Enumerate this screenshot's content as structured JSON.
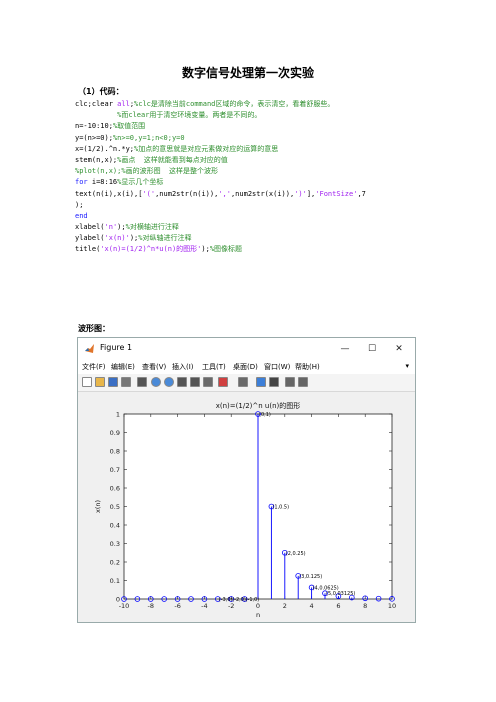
{
  "doc": {
    "title": "数字信号处理第一次实验",
    "section_code": "（1）代码：",
    "section_wave": "波形图："
  },
  "code_lines": [
    [
      {
        "t": "clc;clear ",
        "c": ""
      },
      {
        "t": "all",
        "c": "str"
      },
      {
        "t": ";",
        "c": ""
      },
      {
        "t": "%clc是清除当前command区域的命令，表示清空，看着舒服些。",
        "c": "cm"
      }
    ],
    [
      {
        "t": "          %而clear用于清空环境变量。两者是不同的。",
        "c": "cm"
      }
    ],
    [
      {
        "t": "n=-10:10;",
        "c": ""
      },
      {
        "t": "%取值范围",
        "c": "cm"
      }
    ],
    [
      {
        "t": "y=(n>=0);",
        "c": ""
      },
      {
        "t": "%n>=0,y=1;n<0;y=0",
        "c": "cm"
      }
    ],
    [
      {
        "t": "x=(1/2).^n.*y;",
        "c": ""
      },
      {
        "t": "%加点的意思就是对应元素做对应的运算的意思",
        "c": "cm"
      }
    ],
    [
      {
        "t": "stem(n,x);",
        "c": ""
      },
      {
        "t": "%画点  这样就能看到每点对应的值",
        "c": "cm"
      }
    ],
    [
      {
        "t": "%plot(n,x);%画的波形图  这样是整个波形",
        "c": "cm"
      }
    ],
    [
      {
        "t": "for ",
        "c": "kw"
      },
      {
        "t": "i=8:16",
        "c": ""
      },
      {
        "t": "%显示几个坐标",
        "c": "cm"
      }
    ],
    [
      {
        "t": "text(n(i),x(i),[",
        "c": ""
      },
      {
        "t": "'('",
        "c": "str"
      },
      {
        "t": ",num2str(n(i)),",
        "c": ""
      },
      {
        "t": "','",
        "c": "str"
      },
      {
        "t": ",num2str(x(i)),",
        "c": ""
      },
      {
        "t": "')'",
        "c": "str"
      },
      {
        "t": "],",
        "c": ""
      },
      {
        "t": "'FontSize'",
        "c": "str"
      },
      {
        "t": ",7",
        "c": ""
      }
    ],
    [
      {
        "t": ");",
        "c": ""
      }
    ],
    [
      {
        "t": "end",
        "c": "kw"
      }
    ],
    [
      {
        "t": "xlabel(",
        "c": ""
      },
      {
        "t": "'n'",
        "c": "str"
      },
      {
        "t": ");",
        "c": ""
      },
      {
        "t": "%对横轴进行注释",
        "c": "cm"
      }
    ],
    [
      {
        "t": "ylabel(",
        "c": ""
      },
      {
        "t": "'x(n)'",
        "c": "str"
      },
      {
        "t": ");",
        "c": ""
      },
      {
        "t": "%对纵轴进行注释",
        "c": "cm"
      }
    ],
    [
      {
        "t": "title(",
        "c": ""
      },
      {
        "t": "'x(n)=(1/2)^n*u(n)的图形'",
        "c": "str"
      },
      {
        "t": ");",
        "c": ""
      },
      {
        "t": "%图像标题",
        "c": "cm"
      }
    ]
  ],
  "figure": {
    "window_title": "Figure 1",
    "menu": [
      "文件(F)",
      "编辑(E)",
      "查看(V)",
      "插入(I)",
      "工具(T)",
      "桌面(D)",
      "窗口(W)",
      "帮助(H)"
    ],
    "toolbar_icons": [
      "new-file-icon",
      "open-folder-icon",
      "save-icon",
      "print-icon",
      "pointer-icon",
      "zoom-in-icon",
      "zoom-out-icon",
      "pan-icon",
      "rotate-icon",
      "data-cursor-icon",
      "brush-icon",
      "link-icon",
      "colorbar-icon",
      "legend-icon",
      "hide-tools-icon",
      "show-tools-icon"
    ]
  },
  "chart_data": {
    "type": "stem",
    "title": "x(n)=(1/2)^n u(n)的图形",
    "xlabel": "n",
    "ylabel": "x(n)",
    "xlim": [
      -10,
      10
    ],
    "ylim": [
      0,
      1
    ],
    "xticks": [
      -10,
      -8,
      -6,
      -4,
      -2,
      0,
      2,
      4,
      6,
      8,
      10
    ],
    "yticks": [
      0,
      0.1,
      0.2,
      0.3,
      0.4,
      0.5,
      0.6,
      0.7,
      0.8,
      0.9,
      1
    ],
    "x": [
      -10,
      -9,
      -8,
      -7,
      -6,
      -5,
      -4,
      -3,
      -2,
      -1,
      0,
      1,
      2,
      3,
      4,
      5,
      6,
      7,
      8,
      9,
      10
    ],
    "y": [
      0,
      0,
      0,
      0,
      0,
      0,
      0,
      0,
      0,
      0,
      1,
      0.5,
      0.25,
      0.125,
      0.0625,
      0.03125,
      0.015625,
      0.0078125,
      0.00390625,
      0.001953125,
      0.0009765625
    ],
    "annotations": [
      {
        "x": -3,
        "y": 0,
        "text": "(-3,0)"
      },
      {
        "x": -2,
        "y": 0,
        "text": "(-2,0)"
      },
      {
        "x": -1,
        "y": 0,
        "text": "(-1,0)"
      },
      {
        "x": 0,
        "y": 1,
        "text": "(0,1)"
      },
      {
        "x": 1,
        "y": 0.5,
        "text": "(1,0.5)"
      },
      {
        "x": 2,
        "y": 0.25,
        "text": "(2,0.25)"
      },
      {
        "x": 3,
        "y": 0.125,
        "text": "(3,0.125)"
      },
      {
        "x": 4,
        "y": 0.0625,
        "text": "(4,0.0625)"
      },
      {
        "x": 5,
        "y": 0.03125,
        "text": "(5,0.03125)"
      }
    ],
    "color": "#0000ff"
  }
}
